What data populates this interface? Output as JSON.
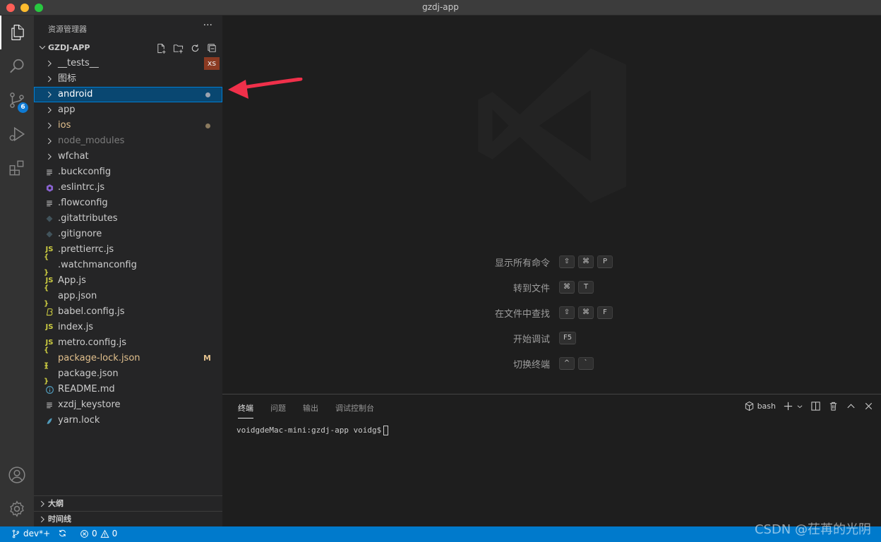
{
  "window": {
    "title": "gzdj-app"
  },
  "activity": {
    "scm_badge": "6"
  },
  "sidebar": {
    "title": "资源管理器",
    "more": "···",
    "project": "GZDJ-APP",
    "items": [
      {
        "label": "__tests__",
        "kind": "folder",
        "color": "#cccccc",
        "badge": "xs"
      },
      {
        "label": "图标",
        "kind": "folder",
        "color": "#cccccc"
      },
      {
        "label": "android",
        "kind": "folder",
        "color": "#ffffff",
        "dot": "#9ca3af",
        "selected": true
      },
      {
        "label": "app",
        "kind": "folder",
        "color": "#cccccc"
      },
      {
        "label": "ios",
        "kind": "folder",
        "color": "#e2c08d",
        "dot": "#8b7a5e"
      },
      {
        "label": "node_modules",
        "kind": "folder",
        "color": "#7b7b7b"
      },
      {
        "label": "wfchat",
        "kind": "folder",
        "color": "#cccccc"
      },
      {
        "label": ".buckconfig",
        "kind": "lines",
        "color": "#cccccc"
      },
      {
        "label": ".eslintrc.js",
        "kind": "eslint",
        "color": "#cccccc"
      },
      {
        "label": ".flowconfig",
        "kind": "lines",
        "color": "#cccccc"
      },
      {
        "label": ".gitattributes",
        "kind": "git",
        "color": "#cccccc"
      },
      {
        "label": ".gitignore",
        "kind": "git",
        "color": "#cccccc"
      },
      {
        "label": ".prettierrc.js",
        "kind": "js",
        "color": "#cccccc"
      },
      {
        "label": ".watchmanconfig",
        "kind": "json",
        "color": "#cccccc"
      },
      {
        "label": "App.js",
        "kind": "js",
        "color": "#cccccc"
      },
      {
        "label": "app.json",
        "kind": "json",
        "color": "#cccccc"
      },
      {
        "label": "babel.config.js",
        "kind": "babel",
        "color": "#cccccc"
      },
      {
        "label": "index.js",
        "kind": "js",
        "color": "#cccccc"
      },
      {
        "label": "metro.config.js",
        "kind": "js",
        "color": "#cccccc"
      },
      {
        "label": "package-lock.json",
        "kind": "json",
        "color": "#e2c08d",
        "deco": "M"
      },
      {
        "label": "package.json",
        "kind": "json",
        "color": "#cccccc"
      },
      {
        "label": "README.md",
        "kind": "info",
        "color": "#cccccc"
      },
      {
        "label": "xzdj_keystore",
        "kind": "lines",
        "color": "#cccccc"
      },
      {
        "label": "yarn.lock",
        "kind": "yarn",
        "color": "#cccccc"
      }
    ],
    "outline": "大纲",
    "timeline": "时间线"
  },
  "editor": {
    "shortcuts": [
      {
        "label": "显示所有命令",
        "keys": [
          "⇧",
          "⌘",
          "P"
        ]
      },
      {
        "label": "转到文件",
        "keys": [
          "⌘",
          "T"
        ]
      },
      {
        "label": "在文件中查找",
        "keys": [
          "⇧",
          "⌘",
          "F"
        ]
      },
      {
        "label": "开始调试",
        "keys": [
          "F5"
        ]
      },
      {
        "label": "切换终端",
        "keys": [
          "^",
          "`"
        ]
      }
    ]
  },
  "panel": {
    "tabs": [
      "终端",
      "问题",
      "输出",
      "调试控制台"
    ],
    "shell": "bash",
    "prompt": "voidgdeMac-mini:gzdj-app voidg$"
  },
  "status": {
    "branch": "dev*+",
    "errors": "0",
    "warnings": "0"
  },
  "watermark_text": "CSDN @茌苒的光阴",
  "colors": {
    "accent": "#007acc",
    "selection": "#094771",
    "arrow": "#f0304a"
  }
}
